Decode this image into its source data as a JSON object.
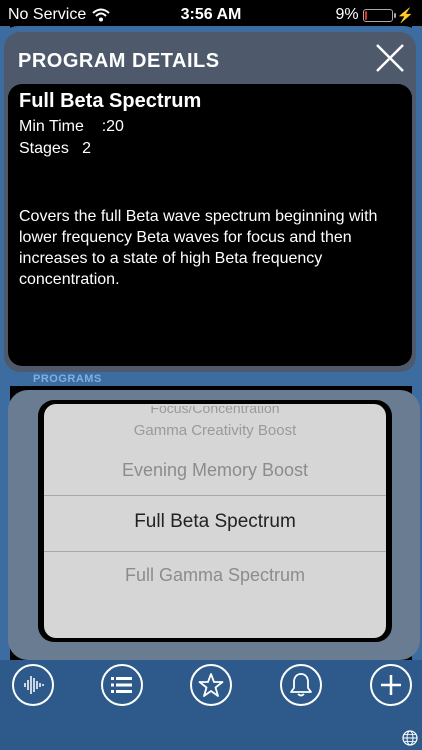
{
  "status_bar": {
    "carrier": "No Service",
    "time": "3:56 AM",
    "battery_percent": "9%",
    "battery_level": 0.09
  },
  "details": {
    "header": "PROGRAM DETAILS",
    "program_name": "Full Beta Spectrum",
    "min_time_label": "Min Time",
    "min_time_value": ":20",
    "stages_label": "Stages",
    "stages_value": "2",
    "description": "Covers the full Beta wave spectrum beginning with lower frequency Beta waves for focus and then increases to a state of high Beta frequency concentration."
  },
  "programs": {
    "label": "PROGRAMS",
    "items": [
      "Focus/Concentration",
      "Gamma Creativity Boost",
      "Evening Memory Boost",
      "Full Beta Spectrum",
      "Full Gamma Spectrum"
    ],
    "selected_index": 3
  },
  "tabs": [
    "waveform-icon",
    "list-icon",
    "star-icon",
    "bell-icon",
    "plus-icon"
  ],
  "colors": {
    "frame_blue": "#3d6da0",
    "panel_gray": "#4e5a6b",
    "picker_bg": "#d6d6d6"
  }
}
